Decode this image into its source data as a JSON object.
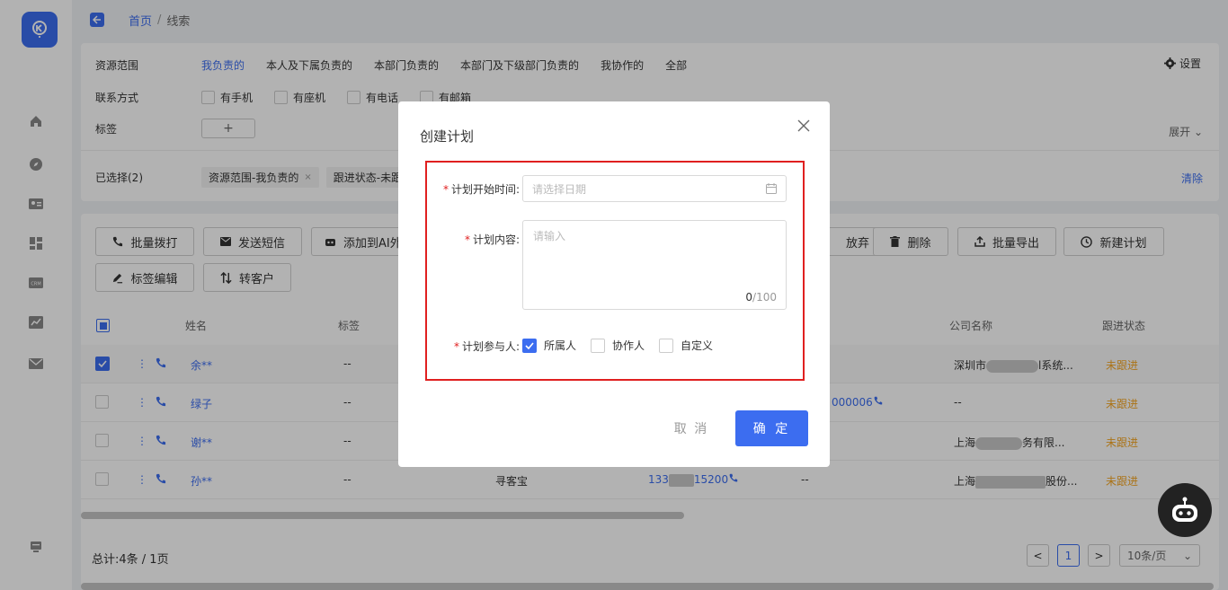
{
  "breadcrumb": {
    "home": "首页",
    "sep": "/",
    "current": "线索"
  },
  "filters": {
    "scope_label": "资源范围",
    "scope_options": [
      "我负责的",
      "本人及下属负责的",
      "本部门负责的",
      "本部门及下级部门负责的",
      "我协作的",
      "全部"
    ],
    "contact_label": "联系方式",
    "contact_options": [
      "有手机",
      "有座机",
      "有电话",
      "有邮箱"
    ],
    "tag_label": "标签",
    "tag_add": "+",
    "settings": "设置",
    "expand": "展开",
    "selected_label": "已选择(2)",
    "chips": [
      "资源范围-我负责的",
      "跟进状态-未跟"
    ],
    "chip_close": "×",
    "clear": "清除"
  },
  "toolbar": {
    "batch_call": "批量拨打",
    "send_sms": "发送短信",
    "add_ai": "添加到AI外",
    "abandon": "放弃",
    "delete": "删除",
    "batch_export": "批量导出",
    "new_plan": "新建计划",
    "tag_edit": "标签编辑",
    "to_customer": "转客户"
  },
  "table": {
    "headers": {
      "name": "姓名",
      "tag": "标签",
      "company": "公司名称",
      "status": "跟进状态"
    },
    "rows": [
      {
        "name": "余**",
        "tag": "--",
        "col3": "",
        "phone": "",
        "col5": "",
        "company_pre": "深圳市",
        "company_post": "l系统...",
        "status": "未跟进",
        "checked": true
      },
      {
        "name": "绿子",
        "tag": "--",
        "col3": "",
        "phone": "000006",
        "col5": "",
        "company_pre": "--",
        "company_post": "",
        "status": "未跟进",
        "checked": false
      },
      {
        "name": "谢**",
        "tag": "--",
        "col3": "",
        "phone": "",
        "col5": "",
        "company_pre": "上海",
        "company_post": "务有限...",
        "status": "未跟进",
        "checked": false
      },
      {
        "name": "孙**",
        "tag": "--",
        "col3": "寻客宝",
        "phone_pre": "133",
        "phone": "15200",
        "col5": "--",
        "company_pre": "上海",
        "company_post": "股份...",
        "status": "未跟进",
        "checked": false
      }
    ]
  },
  "pagination": {
    "total": "总计:4条 / 1页",
    "prev": "<",
    "page": "1",
    "next": ">",
    "size": "10条/页"
  },
  "modal": {
    "title": "创建计划",
    "start_label": "计划开始时间:",
    "start_placeholder": "请选择日期",
    "content_label": "计划内容:",
    "content_placeholder": "请输入",
    "count_current": "0",
    "count_max": "/100",
    "participants_label": "计划参与人:",
    "participants": [
      {
        "label": "所属人",
        "checked": true
      },
      {
        "label": "协作人",
        "checked": false
      },
      {
        "label": "自定义",
        "checked": false
      }
    ],
    "required_mark": "*",
    "cancel": "取 消",
    "confirm": "确 定"
  },
  "colors": {
    "accent": "#3c6df0",
    "required": "#e02020",
    "status": "#f5a623"
  }
}
